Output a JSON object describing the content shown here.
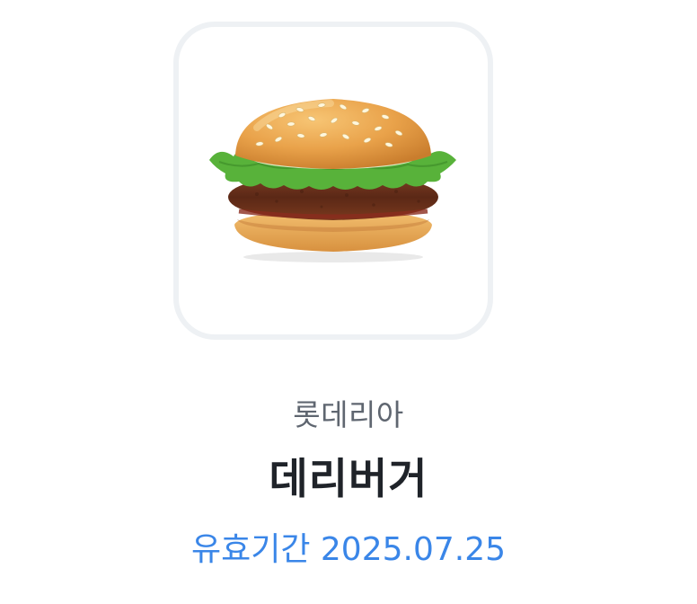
{
  "product": {
    "image_icon": "hamburger-icon",
    "brand": "롯데리아",
    "name": "데리버거",
    "validity_label": "유효기간",
    "validity_date": "2025.07.25"
  },
  "colors": {
    "card_border": "#eef1f4",
    "brand_text": "#5f6670",
    "name_text": "#1f2329",
    "validity_text": "#3a86e8"
  }
}
